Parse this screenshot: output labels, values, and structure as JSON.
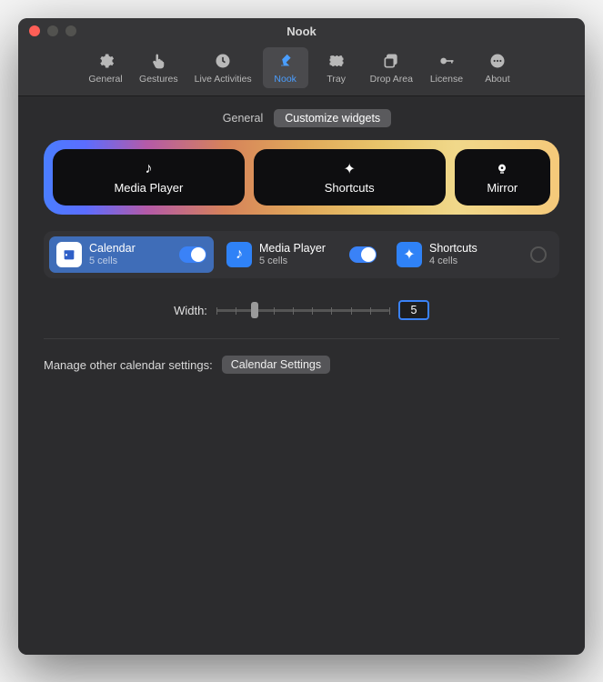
{
  "window": {
    "title": "Nook"
  },
  "toolbar": {
    "items": [
      {
        "label": "General"
      },
      {
        "label": "Gestures"
      },
      {
        "label": "Live Activities"
      },
      {
        "label": "Nook"
      },
      {
        "label": "Tray"
      },
      {
        "label": "Drop Area"
      },
      {
        "label": "License"
      },
      {
        "label": "About"
      }
    ],
    "active_index": 3
  },
  "segmented": {
    "general": "General",
    "customize": "Customize widgets",
    "active": "customize"
  },
  "preview": [
    {
      "label": "Media Player",
      "icon": "music-note"
    },
    {
      "label": "Shortcuts",
      "icon": "sparkle"
    },
    {
      "label": "Mirror",
      "icon": "webcam"
    }
  ],
  "widgets": [
    {
      "name": "Calendar",
      "cells": "5 cells",
      "icon_bg": "#ffffff",
      "icon_fg": "#2f5fc7",
      "icon": "calendar",
      "toggle": true,
      "selected": true
    },
    {
      "name": "Media Player",
      "cells": "5 cells",
      "icon_bg": "#2f82f7",
      "icon_fg": "#ffffff",
      "icon": "music-note",
      "toggle": true,
      "selected": false
    },
    {
      "name": "Shortcuts",
      "cells": "4 cells",
      "icon_bg": "#2f82f7",
      "icon_fg": "#ffffff",
      "icon": "sparkle",
      "toggle": null,
      "selected": false
    }
  ],
  "width": {
    "label": "Width:",
    "value": "5",
    "min": 1,
    "max": 10
  },
  "manage": {
    "label": "Manage other calendar settings:",
    "button": "Calendar Settings"
  }
}
